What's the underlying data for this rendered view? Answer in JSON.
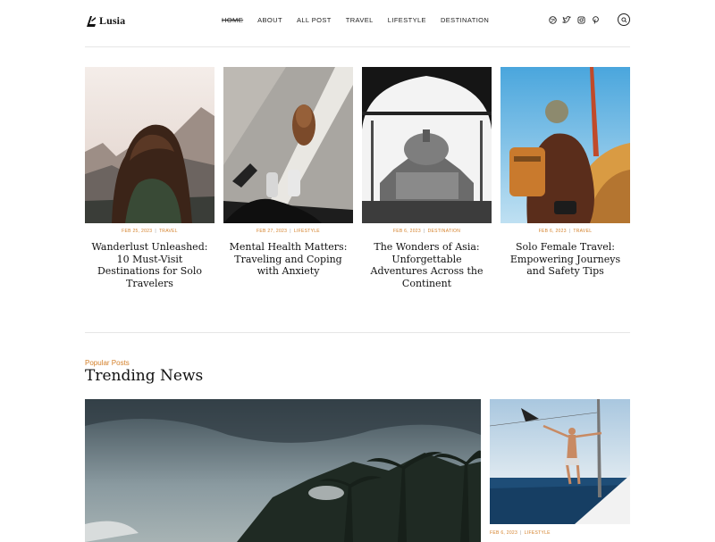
{
  "site": {
    "name": "Lusia"
  },
  "nav": [
    {
      "label": "Home",
      "active": true
    },
    {
      "label": "About"
    },
    {
      "label": "All Post"
    },
    {
      "label": "Travel"
    },
    {
      "label": "Lifestyle"
    },
    {
      "label": "Destination"
    }
  ],
  "socials": [
    "dribbble-icon",
    "twitter-icon",
    "instagram-icon",
    "pinterest-icon"
  ],
  "featured": [
    {
      "date": "FEB 25, 2023",
      "category": "TRAVEL",
      "title": "Wanderlust Unleashed: 10 Must-Visit Destinations for Solo Travelers"
    },
    {
      "date": "FEB 27, 2023",
      "category": "LIFESTYLE",
      "title": "Mental Health Matters: Traveling and Coping with Anxiety"
    },
    {
      "date": "FEB 6, 2023",
      "category": "DESTINATION",
      "title": "The Wonders of Asia: Unforgettable Adventures Across the Continent"
    },
    {
      "date": "FEB 6, 2023",
      "category": "TRAVEL",
      "title": "Solo Female Travel: Empowering Journeys and Safety Tips"
    }
  ],
  "trending": {
    "kicker": "Popular Posts",
    "title": "Trending News",
    "side_post": {
      "date": "FEB 6, 2023",
      "category": "LIFESTYLE"
    }
  },
  "colors": {
    "accent": "#d4802a",
    "text": "#111111",
    "rule": "#e6e6e6"
  }
}
